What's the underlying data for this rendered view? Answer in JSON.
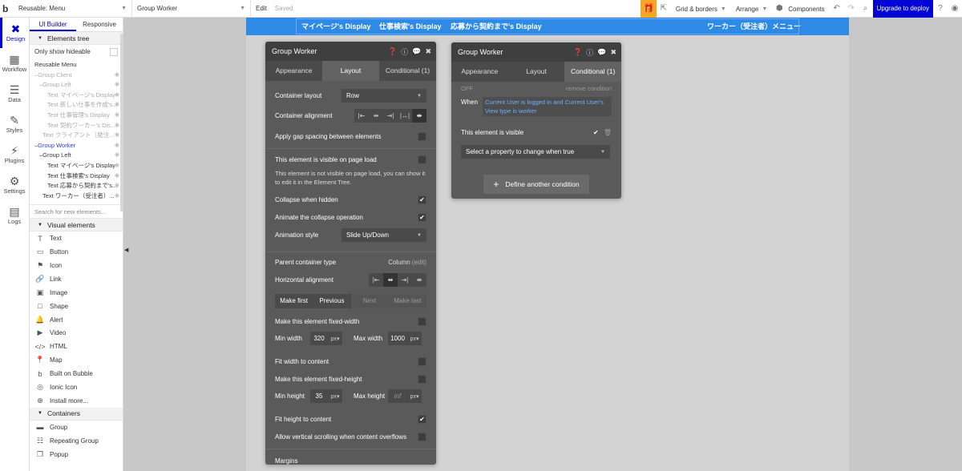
{
  "topbar": {
    "logo": "b",
    "page_select": "Reusable: Menu",
    "element_select": "Group Worker",
    "edit": "Edit",
    "saved": "Saved",
    "gift_icon": "gift-icon",
    "grid_borders": "Grid & borders",
    "arrange": "Arrange",
    "components": "Components",
    "upgrade": "Upgrade to deploy"
  },
  "leftnav": [
    {
      "label": "Design",
      "icon": "design-icon"
    },
    {
      "label": "Workflow",
      "icon": "workflow-icon"
    },
    {
      "label": "Data",
      "icon": "database-icon"
    },
    {
      "label": "Styles",
      "icon": "brush-icon"
    },
    {
      "label": "Plugins",
      "icon": "plug-icon"
    },
    {
      "label": "Settings",
      "icon": "gear-icon"
    },
    {
      "label": "Logs",
      "icon": "document-icon"
    }
  ],
  "elements_panel": {
    "tabs": [
      "UI Builder",
      "Responsive"
    ],
    "tree_header": "Elements tree",
    "only_hideable": "Only show hideable",
    "tree": [
      {
        "label": "Reusable Menu",
        "indent": 0,
        "state": "normal"
      },
      {
        "label": "Group Client",
        "indent": 0,
        "state": "dim"
      },
      {
        "label": "Group Left",
        "indent": 1,
        "state": "dim"
      },
      {
        "label": "Text マイページ's Display",
        "indent": 2,
        "state": "dim"
      },
      {
        "label": "Text 新しい仕事を作成's...",
        "indent": 2,
        "state": "dim"
      },
      {
        "label": "Text 仕事管理's Display",
        "indent": 2,
        "state": "dim"
      },
      {
        "label": "Text 契約ワーカー's Dis...",
        "indent": 2,
        "state": "dim"
      },
      {
        "label": "Text クライアント（発注...",
        "indent": 1,
        "state": "dim"
      },
      {
        "label": "Group Worker",
        "indent": 0,
        "state": "sel"
      },
      {
        "label": "Group Left",
        "indent": 1,
        "state": "normal"
      },
      {
        "label": "Text マイページ's Display",
        "indent": 2,
        "state": "normal"
      },
      {
        "label": "Text 仕事検索's Display",
        "indent": 2,
        "state": "normal"
      },
      {
        "label": "Text 応募から契約まで's...",
        "indent": 2,
        "state": "normal"
      },
      {
        "label": "Text ワーカー（受注者）...",
        "indent": 1,
        "state": "normal"
      }
    ],
    "search_placeholder": "Search for new elements...",
    "visual_header": "Visual elements",
    "visual": [
      {
        "label": "Text",
        "icon": "text-icon"
      },
      {
        "label": "Button",
        "icon": "button-icon"
      },
      {
        "label": "Icon",
        "icon": "flag-icon"
      },
      {
        "label": "Link",
        "icon": "link-icon"
      },
      {
        "label": "Image",
        "icon": "image-icon"
      },
      {
        "label": "Shape",
        "icon": "shape-icon"
      },
      {
        "label": "Alert",
        "icon": "bell-icon"
      },
      {
        "label": "Video",
        "icon": "video-icon"
      },
      {
        "label": "HTML",
        "icon": "code-icon"
      },
      {
        "label": "Map",
        "icon": "map-pin-icon"
      },
      {
        "label": "Built on Bubble",
        "icon": "bubble-icon"
      },
      {
        "label": "Ionic Icon",
        "icon": "ionic-icon"
      },
      {
        "label": "Install more...",
        "icon": "plus-circle-icon"
      }
    ],
    "containers_header": "Containers",
    "containers": [
      {
        "label": "Group",
        "icon": "group-icon"
      },
      {
        "label": "Repeating Group",
        "icon": "repeating-group-icon"
      },
      {
        "label": "Popup",
        "icon": "popup-icon"
      }
    ]
  },
  "canvas": {
    "header_items": [
      "マイページ's Display",
      "仕事検索's Display",
      "応募から契約まで's Display",
      "ワーカー（受注者）メニュー"
    ]
  },
  "editor1": {
    "title": "Group Worker",
    "tabs": [
      "Appearance",
      "Layout",
      "Conditional (1)"
    ],
    "container_layout_label": "Container layout",
    "container_layout_value": "Row",
    "container_alignment_label": "Container alignment",
    "gap_label": "Apply gap spacing between elements",
    "visible_label": "This element is visible on page load",
    "visible_note": "This element is not visible on page load, you can show it to edit it in the Element Tree.",
    "collapse_label": "Collapse when hidden",
    "animate_label": "Animate the collapse operation",
    "anim_style_label": "Animation style",
    "anim_style_value": "Slide Up/Down",
    "parent_type_label": "Parent container type",
    "parent_type_value": "Column",
    "parent_type_edit": "(edit)",
    "h_align_label": "Horizontal alignment",
    "order_buttons": [
      "Make first",
      "Previous",
      "Next",
      "Make last"
    ],
    "fixed_width_label": "Make this element fixed-width",
    "min_width_label": "Min width",
    "min_width_value": "320",
    "max_width_label": "Max width",
    "max_width_value": "1000",
    "unit": "px",
    "fit_width_label": "Fit width to content",
    "fixed_height_label": "Make this element fixed-height",
    "min_height_label": "Min height",
    "min_height_value": "35",
    "max_height_label": "Max height",
    "max_height_value": "inf",
    "fit_height_label": "Fit height to content",
    "scroll_label": "Allow vertical scrolling when content overflows",
    "margins_label": "Margins"
  },
  "editor2": {
    "title": "Group Worker",
    "tabs": [
      "Appearance",
      "Layout",
      "Conditional (1)"
    ],
    "off_label": "OFF",
    "remove_label": "remove condition",
    "when_label": "When",
    "condition": "Current User is logged in and Current User's View type is worker",
    "visible_label": "This element is visible",
    "property_placeholder": "Select a property to change when true",
    "define_button": "Define another condition"
  }
}
